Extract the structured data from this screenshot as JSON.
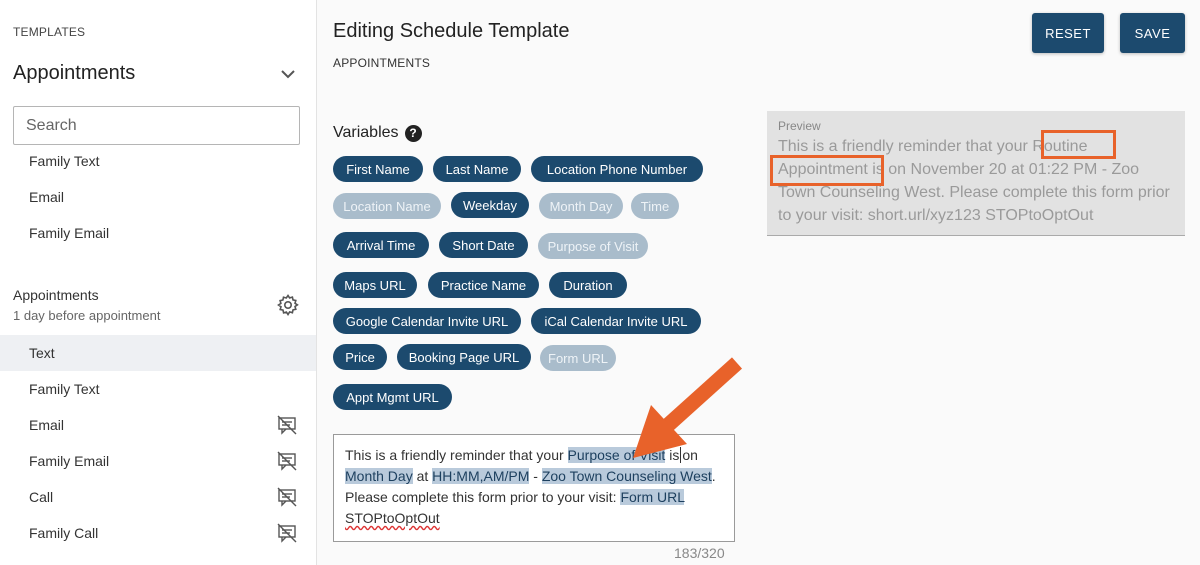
{
  "sidebar": {
    "caption": "TEMPLATES",
    "title": "Appointments",
    "search_placeholder": "Search",
    "top_items": [
      "Family Text",
      "Email",
      "Family Email"
    ],
    "group": {
      "name": "Appointments",
      "subtitle": "1 day before appointment"
    },
    "group_items": [
      "Text",
      "Family Text",
      "Email",
      "Family Email",
      "Call",
      "Family Call"
    ],
    "selected_item": "Text"
  },
  "main": {
    "title": "Editing Schedule Template",
    "subtitle": "APPOINTMENTS",
    "reset_label": "RESET",
    "save_label": "SAVE",
    "variables_heading": "Variables",
    "variables": [
      {
        "label": "First Name",
        "enabled": true
      },
      {
        "label": "Last Name",
        "enabled": true
      },
      {
        "label": "Location Phone Number",
        "enabled": true
      },
      {
        "label": "Location Name",
        "enabled": false
      },
      {
        "label": "Weekday",
        "enabled": true
      },
      {
        "label": "Month Day",
        "enabled": false
      },
      {
        "label": "Time",
        "enabled": false
      },
      {
        "label": "Arrival Time",
        "enabled": true
      },
      {
        "label": "Short Date",
        "enabled": true
      },
      {
        "label": "Purpose of Visit",
        "enabled": false
      },
      {
        "label": "Maps URL",
        "enabled": true
      },
      {
        "label": "Practice Name",
        "enabled": true
      },
      {
        "label": "Duration",
        "enabled": true
      },
      {
        "label": "Google Calendar Invite URL",
        "enabled": true
      },
      {
        "label": "iCal Calendar Invite URL",
        "enabled": true
      },
      {
        "label": "Price",
        "enabled": true
      },
      {
        "label": "Booking Page URL",
        "enabled": true
      },
      {
        "label": "Form URL",
        "enabled": false
      },
      {
        "label": "Appt Mgmt URL",
        "enabled": true
      }
    ],
    "editor": {
      "t1": "This is a friendly reminder that your ",
      "tok1": "Purpose of Visit",
      "t2": " is",
      "t3": "on ",
      "tok2": "Month Day",
      "t4": " at ",
      "tok3": "HH:MM,AM/PM",
      "t5": " - ",
      "tok4": "Zoo Town Counseling West",
      "t6": ". Please complete this form prior to your visit: ",
      "tok5": "Form URL",
      "t7": " ",
      "tok6": "STOPtoOptOut"
    },
    "counter": "183/320",
    "preview": {
      "label": "Preview",
      "text": "This is a friendly reminder that your Routine Appointment is on November 20 at 01:22 PM - Zoo Town Counseling West. Please complete this form prior to your visit: short.url/xyz123  STOPtoOptOut"
    }
  },
  "colors": {
    "primary": "#1c4a6e",
    "chip_disabled": "#a9bccb",
    "annotation": "#e8622a"
  }
}
